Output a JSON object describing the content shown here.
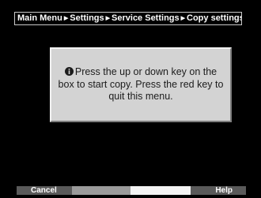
{
  "breadcrumb": {
    "items": [
      "Main Menu",
      "Settings",
      "Service Settings",
      "Copy settings"
    ],
    "separator_glyph": "▶"
  },
  "dialog": {
    "icon": "info-icon",
    "message": "Press the up or down key on the box to start copy. Press the red key to quit this menu."
  },
  "bottombar": {
    "red_label": "Cancel",
    "green_label": "",
    "yellow_label": "",
    "blue_label": "Help"
  },
  "colors": {
    "background": "#000000",
    "dialog_background": "#d3d3d3",
    "dialog_text": "#1c1c1c",
    "bar_dark": "#5a5a5a",
    "bar_mid": "#9b9b9b",
    "bar_light": "#f4f4f4"
  }
}
